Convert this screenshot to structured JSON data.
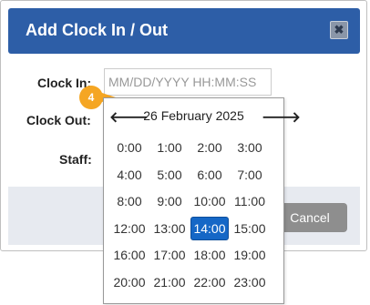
{
  "dialog": {
    "title": "Add Clock In / Out",
    "close_icon": "close-icon"
  },
  "form": {
    "clock_in_label": "Clock In:",
    "clock_in_placeholder": "MM/DD/YYYY HH:MM:SS",
    "clock_out_label": "Clock Out:",
    "staff_label": "Staff:"
  },
  "callout": {
    "number": "4",
    "color": "#f5a623"
  },
  "footer": {
    "cancel_label": "Cancel"
  },
  "picker": {
    "month_label": "26 February 2025",
    "prev_icon": "arrow-left-icon",
    "next_icon": "arrow-right-icon",
    "selected_time": "14:00",
    "times": [
      "0:00",
      "1:00",
      "2:00",
      "3:00",
      "4:00",
      "5:00",
      "6:00",
      "7:00",
      "8:00",
      "9:00",
      "10:00",
      "11:00",
      "12:00",
      "13:00",
      "14:00",
      "15:00",
      "16:00",
      "17:00",
      "18:00",
      "19:00",
      "20:00",
      "21:00",
      "22:00",
      "23:00"
    ]
  },
  "colors": {
    "header": "#2d5ea7",
    "selected": "#1567c6",
    "cancel": "#8e8e8e"
  }
}
